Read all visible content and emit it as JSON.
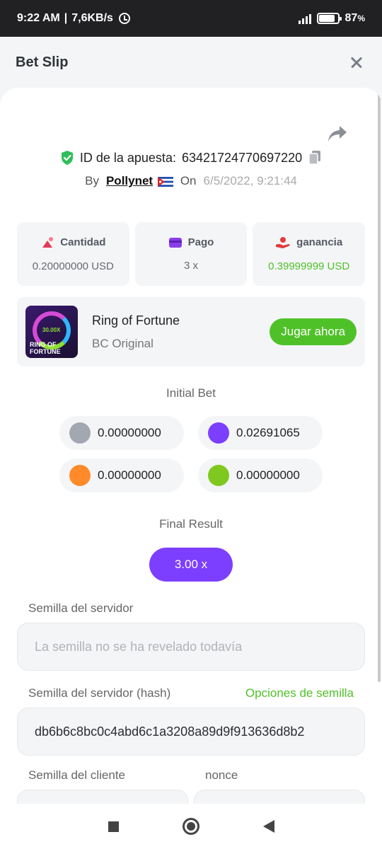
{
  "status_bar": {
    "time": "9:22 AM",
    "network_speed": "7,6KB/s",
    "battery": "87",
    "battery_unit": "%",
    "battery_fraction": 0.87
  },
  "header": {
    "title": "Bet Slip"
  },
  "bet": {
    "id_label": "ID de la apuesta:",
    "id_value": "63421724770697220",
    "by_label": "By",
    "user": "Pollynet",
    "on_label": "On",
    "date": "6/5/2022, 9:21:44"
  },
  "stats": [
    {
      "label": "Cantidad",
      "value": "0.20000000 USD",
      "color": "#e23b5a"
    },
    {
      "label": "Pago",
      "value": "3 x",
      "color": "#8a3ee8"
    },
    {
      "label": "ganancia",
      "value": "0.39999999 USD",
      "color": "#e23b3b",
      "value_color": "#4fc128"
    }
  ],
  "game": {
    "thumb_text": "RING OF FORTUNE",
    "thumb_multiplier": "30.00X",
    "name": "Ring of Fortune",
    "provider": "BC Original",
    "play_label": "Jugar ahora"
  },
  "initial_bet": {
    "label": "Initial Bet",
    "chips": [
      {
        "color": "#a3a8b0",
        "value": "0.00000000"
      },
      {
        "color": "#7d3fff",
        "value": "0.02691065"
      },
      {
        "color": "#ff8a2a",
        "value": "0.00000000"
      },
      {
        "color": "#7fc81f",
        "value": "0.00000000"
      }
    ]
  },
  "final_result": {
    "label": "Final Result",
    "value": "3.00 x"
  },
  "seeds": {
    "server_label": "Semilla del servidor",
    "server_placeholder": "La semilla no se ha revelado todavía",
    "hash_label": "Semilla del servidor (hash)",
    "options_label": "Opciones de semilla",
    "hash_value": "db6b6c8bc0c4abd6c1a3208a89d9f913636d8b2",
    "client_label": "Semilla del cliente",
    "nonce_label": "nonce"
  },
  "colors": {
    "accent_green": "#4fc128",
    "accent_purple": "#7d3fff"
  }
}
